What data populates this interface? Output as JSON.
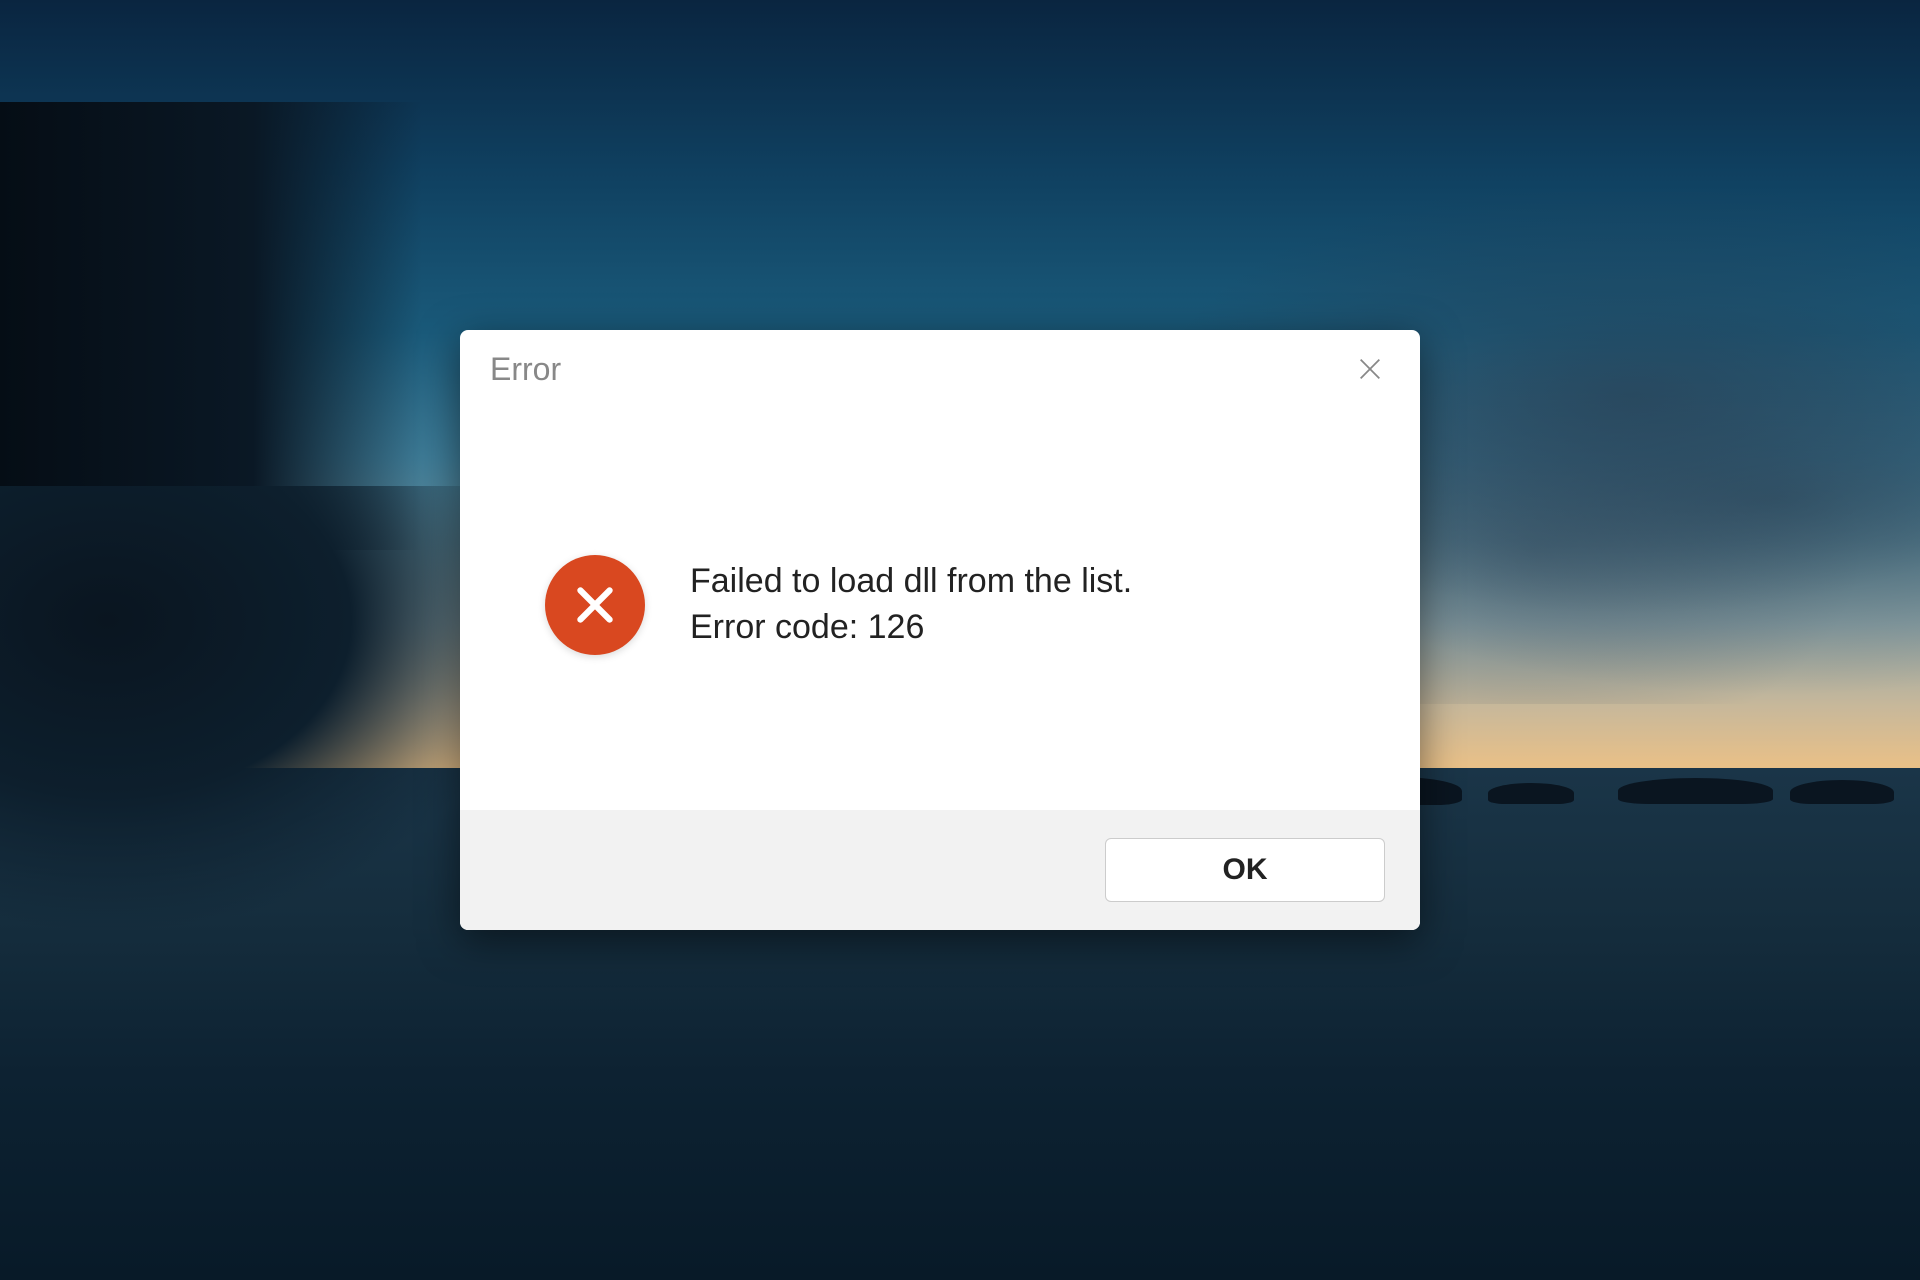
{
  "dialog": {
    "title": "Error",
    "message_line1": "Failed to load dll from the list.",
    "message_line2": "Error code: 126",
    "ok_label": "OK"
  },
  "colors": {
    "error_icon": "#d94820",
    "dialog_bg": "#ffffff",
    "footer_bg": "#f2f2f2"
  }
}
